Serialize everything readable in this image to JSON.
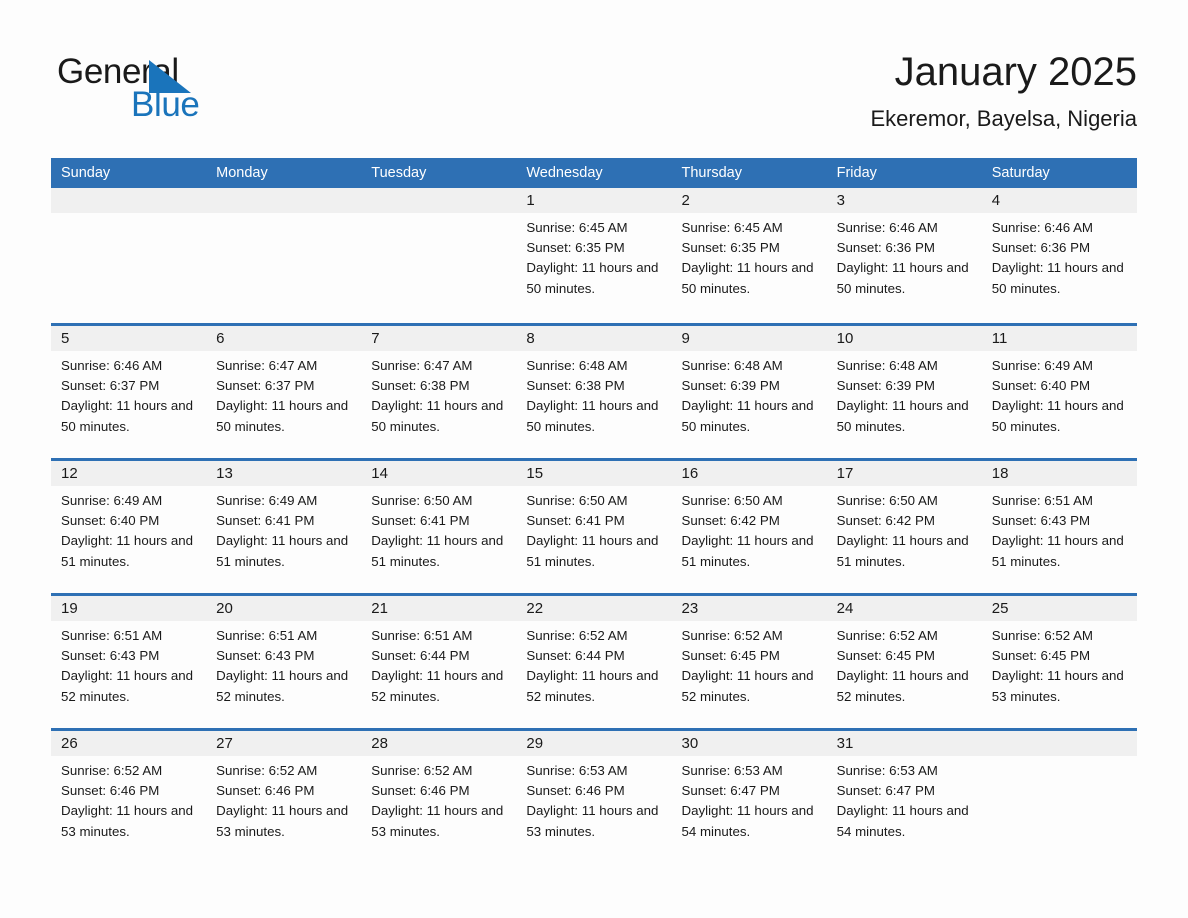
{
  "logo": {
    "word_one": "General",
    "word_two": "Blue",
    "accent_color": "#1a74bb"
  },
  "header": {
    "title": "January 2025",
    "subtitle": "Ekeremor, Bayelsa, Nigeria"
  },
  "theme": {
    "header_blue": "#2e70b4",
    "day_band_gray": "#f0f0f0",
    "page_background": "#fdfdfd",
    "text_color": "#1a1a1a"
  },
  "weekday_headers": [
    "Sunday",
    "Monday",
    "Tuesday",
    "Wednesday",
    "Thursday",
    "Friday",
    "Saturday"
  ],
  "weeks": [
    [
      {
        "day": "",
        "empty": true
      },
      {
        "day": "",
        "empty": true
      },
      {
        "day": "",
        "empty": true
      },
      {
        "day": "1",
        "sunrise": "Sunrise: 6:45 AM",
        "sunset": "Sunset: 6:35 PM",
        "daylight": "Daylight: 11 hours and 50 minutes."
      },
      {
        "day": "2",
        "sunrise": "Sunrise: 6:45 AM",
        "sunset": "Sunset: 6:35 PM",
        "daylight": "Daylight: 11 hours and 50 minutes."
      },
      {
        "day": "3",
        "sunrise": "Sunrise: 6:46 AM",
        "sunset": "Sunset: 6:36 PM",
        "daylight": "Daylight: 11 hours and 50 minutes."
      },
      {
        "day": "4",
        "sunrise": "Sunrise: 6:46 AM",
        "sunset": "Sunset: 6:36 PM",
        "daylight": "Daylight: 11 hours and 50 minutes."
      }
    ],
    [
      {
        "day": "5",
        "sunrise": "Sunrise: 6:46 AM",
        "sunset": "Sunset: 6:37 PM",
        "daylight": "Daylight: 11 hours and 50 minutes."
      },
      {
        "day": "6",
        "sunrise": "Sunrise: 6:47 AM",
        "sunset": "Sunset: 6:37 PM",
        "daylight": "Daylight: 11 hours and 50 minutes."
      },
      {
        "day": "7",
        "sunrise": "Sunrise: 6:47 AM",
        "sunset": "Sunset: 6:38 PM",
        "daylight": "Daylight: 11 hours and 50 minutes."
      },
      {
        "day": "8",
        "sunrise": "Sunrise: 6:48 AM",
        "sunset": "Sunset: 6:38 PM",
        "daylight": "Daylight: 11 hours and 50 minutes."
      },
      {
        "day": "9",
        "sunrise": "Sunrise: 6:48 AM",
        "sunset": "Sunset: 6:39 PM",
        "daylight": "Daylight: 11 hours and 50 minutes."
      },
      {
        "day": "10",
        "sunrise": "Sunrise: 6:48 AM",
        "sunset": "Sunset: 6:39 PM",
        "daylight": "Daylight: 11 hours and 50 minutes."
      },
      {
        "day": "11",
        "sunrise": "Sunrise: 6:49 AM",
        "sunset": "Sunset: 6:40 PM",
        "daylight": "Daylight: 11 hours and 50 minutes."
      }
    ],
    [
      {
        "day": "12",
        "sunrise": "Sunrise: 6:49 AM",
        "sunset": "Sunset: 6:40 PM",
        "daylight": "Daylight: 11 hours and 51 minutes."
      },
      {
        "day": "13",
        "sunrise": "Sunrise: 6:49 AM",
        "sunset": "Sunset: 6:41 PM",
        "daylight": "Daylight: 11 hours and 51 minutes."
      },
      {
        "day": "14",
        "sunrise": "Sunrise: 6:50 AM",
        "sunset": "Sunset: 6:41 PM",
        "daylight": "Daylight: 11 hours and 51 minutes."
      },
      {
        "day": "15",
        "sunrise": "Sunrise: 6:50 AM",
        "sunset": "Sunset: 6:41 PM",
        "daylight": "Daylight: 11 hours and 51 minutes."
      },
      {
        "day": "16",
        "sunrise": "Sunrise: 6:50 AM",
        "sunset": "Sunset: 6:42 PM",
        "daylight": "Daylight: 11 hours and 51 minutes."
      },
      {
        "day": "17",
        "sunrise": "Sunrise: 6:50 AM",
        "sunset": "Sunset: 6:42 PM",
        "daylight": "Daylight: 11 hours and 51 minutes."
      },
      {
        "day": "18",
        "sunrise": "Sunrise: 6:51 AM",
        "sunset": "Sunset: 6:43 PM",
        "daylight": "Daylight: 11 hours and 51 minutes."
      }
    ],
    [
      {
        "day": "19",
        "sunrise": "Sunrise: 6:51 AM",
        "sunset": "Sunset: 6:43 PM",
        "daylight": "Daylight: 11 hours and 52 minutes."
      },
      {
        "day": "20",
        "sunrise": "Sunrise: 6:51 AM",
        "sunset": "Sunset: 6:43 PM",
        "daylight": "Daylight: 11 hours and 52 minutes."
      },
      {
        "day": "21",
        "sunrise": "Sunrise: 6:51 AM",
        "sunset": "Sunset: 6:44 PM",
        "daylight": "Daylight: 11 hours and 52 minutes."
      },
      {
        "day": "22",
        "sunrise": "Sunrise: 6:52 AM",
        "sunset": "Sunset: 6:44 PM",
        "daylight": "Daylight: 11 hours and 52 minutes."
      },
      {
        "day": "23",
        "sunrise": "Sunrise: 6:52 AM",
        "sunset": "Sunset: 6:45 PM",
        "daylight": "Daylight: 11 hours and 52 minutes."
      },
      {
        "day": "24",
        "sunrise": "Sunrise: 6:52 AM",
        "sunset": "Sunset: 6:45 PM",
        "daylight": "Daylight: 11 hours and 52 minutes."
      },
      {
        "day": "25",
        "sunrise": "Sunrise: 6:52 AM",
        "sunset": "Sunset: 6:45 PM",
        "daylight": "Daylight: 11 hours and 53 minutes."
      }
    ],
    [
      {
        "day": "26",
        "sunrise": "Sunrise: 6:52 AM",
        "sunset": "Sunset: 6:46 PM",
        "daylight": "Daylight: 11 hours and 53 minutes."
      },
      {
        "day": "27",
        "sunrise": "Sunrise: 6:52 AM",
        "sunset": "Sunset: 6:46 PM",
        "daylight": "Daylight: 11 hours and 53 minutes."
      },
      {
        "day": "28",
        "sunrise": "Sunrise: 6:52 AM",
        "sunset": "Sunset: 6:46 PM",
        "daylight": "Daylight: 11 hours and 53 minutes."
      },
      {
        "day": "29",
        "sunrise": "Sunrise: 6:53 AM",
        "sunset": "Sunset: 6:46 PM",
        "daylight": "Daylight: 11 hours and 53 minutes."
      },
      {
        "day": "30",
        "sunrise": "Sunrise: 6:53 AM",
        "sunset": "Sunset: 6:47 PM",
        "daylight": "Daylight: 11 hours and 54 minutes."
      },
      {
        "day": "31",
        "sunrise": "Sunrise: 6:53 AM",
        "sunset": "Sunset: 6:47 PM",
        "daylight": "Daylight: 11 hours and 54 minutes."
      },
      {
        "day": "",
        "empty": true
      }
    ]
  ]
}
